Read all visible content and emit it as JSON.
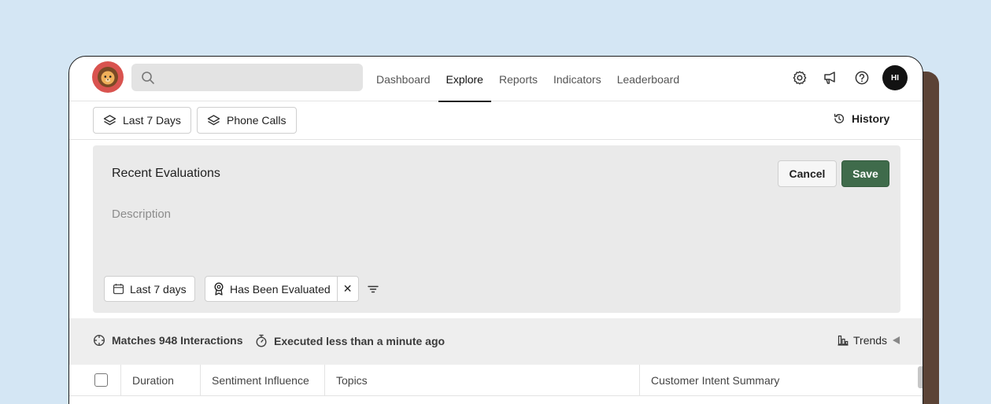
{
  "search": {
    "placeholder": "",
    "value": ""
  },
  "nav": {
    "tabs": [
      {
        "label": "Dashboard",
        "active": false
      },
      {
        "label": "Explore",
        "active": true
      },
      {
        "label": "Reports",
        "active": false
      },
      {
        "label": "Indicators",
        "active": false
      },
      {
        "label": "Leaderboard",
        "active": false
      }
    ],
    "icons": [
      "gear-icon",
      "megaphone-icon",
      "help-icon"
    ],
    "avatar_initials": "HI"
  },
  "filterbar": {
    "date_chip": "Last 7 Days",
    "source_chip": "Phone Calls",
    "history_label": "History"
  },
  "editor": {
    "title_value": "Recent Evaluations",
    "description_placeholder": "Description",
    "cancel_label": "Cancel",
    "save_label": "Save",
    "filters": {
      "date_filter": "Last 7 days",
      "evaluated_filter": "Has Been Evaluated",
      "remove_symbol": "✕"
    }
  },
  "stats": {
    "matches": "Matches 948 Interactions",
    "executed": "Executed less than a minute ago",
    "trends_label": "Trends"
  },
  "table": {
    "columns": [
      "Duration",
      "Sentiment Influence",
      "Topics",
      "Customer Intent Summary"
    ]
  },
  "colors": {
    "background": "#d4e6f4",
    "accent_save": "#3f6b4b",
    "logo": "#d9534f",
    "side_panel": "#5b4336"
  }
}
